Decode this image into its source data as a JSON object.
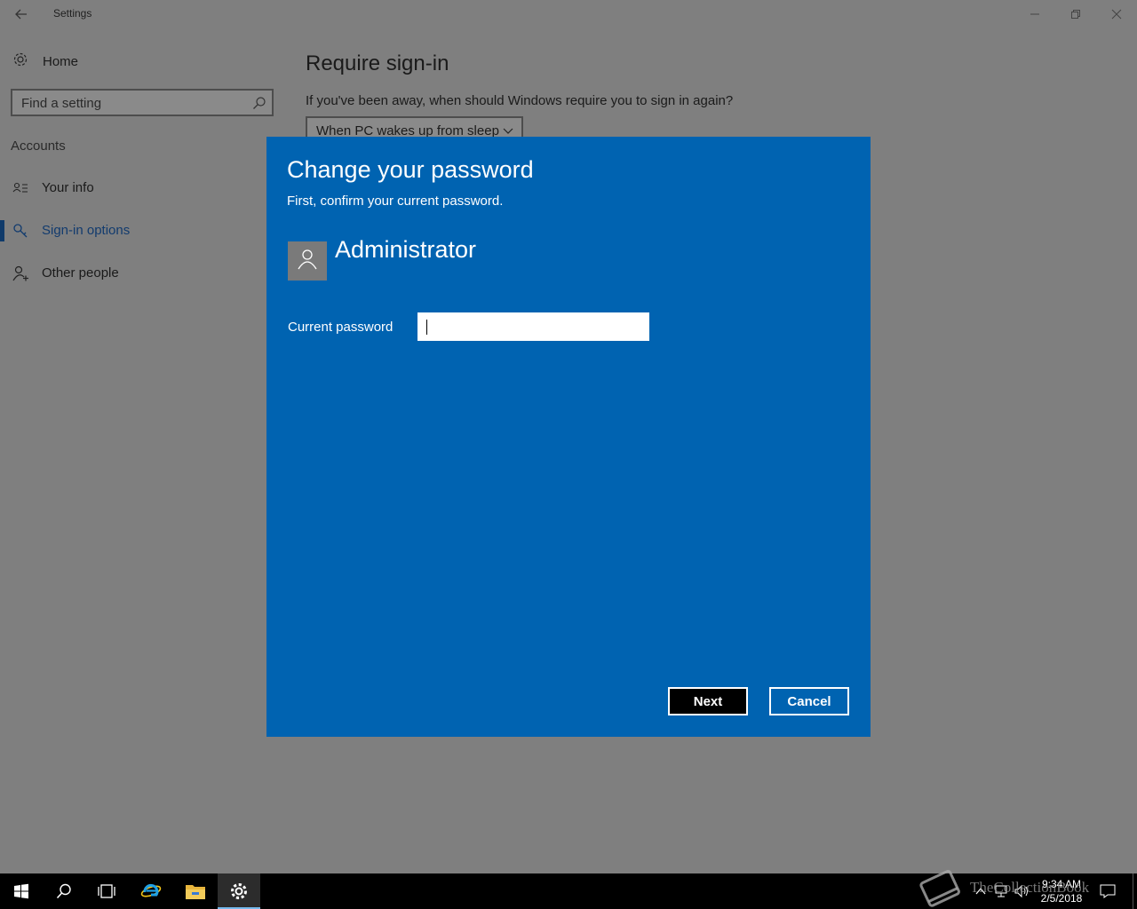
{
  "window": {
    "title": "Settings",
    "icons": {
      "back": "back-arrow-icon",
      "minimize": "minimize-icon",
      "maximize": "restore-icon",
      "close": "close-icon"
    }
  },
  "sidebar": {
    "home_label": "Home",
    "search_placeholder": "Find a setting",
    "section_label": "Accounts",
    "items": [
      {
        "label": "Your info",
        "icon": "contact-card-icon",
        "selected": false
      },
      {
        "label": "Sign-in options",
        "icon": "key-icon",
        "selected": true
      },
      {
        "label": "Other people",
        "icon": "person-add-icon",
        "selected": false
      }
    ]
  },
  "main": {
    "title": "Require sign-in",
    "question": "If you've been away, when should Windows require you to sign in again?",
    "dropdown_value": "When PC wakes up from sleep"
  },
  "dialog": {
    "title": "Change your password",
    "subtitle": "First, confirm your current password.",
    "user_name": "Administrator",
    "password_label": "Current password",
    "password_value": "",
    "next_label": "Next",
    "cancel_label": "Cancel",
    "bg_color": "#0063b1"
  },
  "taskbar": {
    "apps": [
      "start-icon",
      "search-icon",
      "task-view-icon",
      "internet-explorer-icon",
      "file-explorer-icon",
      "settings-icon"
    ],
    "active_app": "settings-icon",
    "clock_time": "9:34 AM",
    "clock_date": "2/5/2018"
  },
  "watermark": {
    "text": "TheCollectionBook"
  }
}
